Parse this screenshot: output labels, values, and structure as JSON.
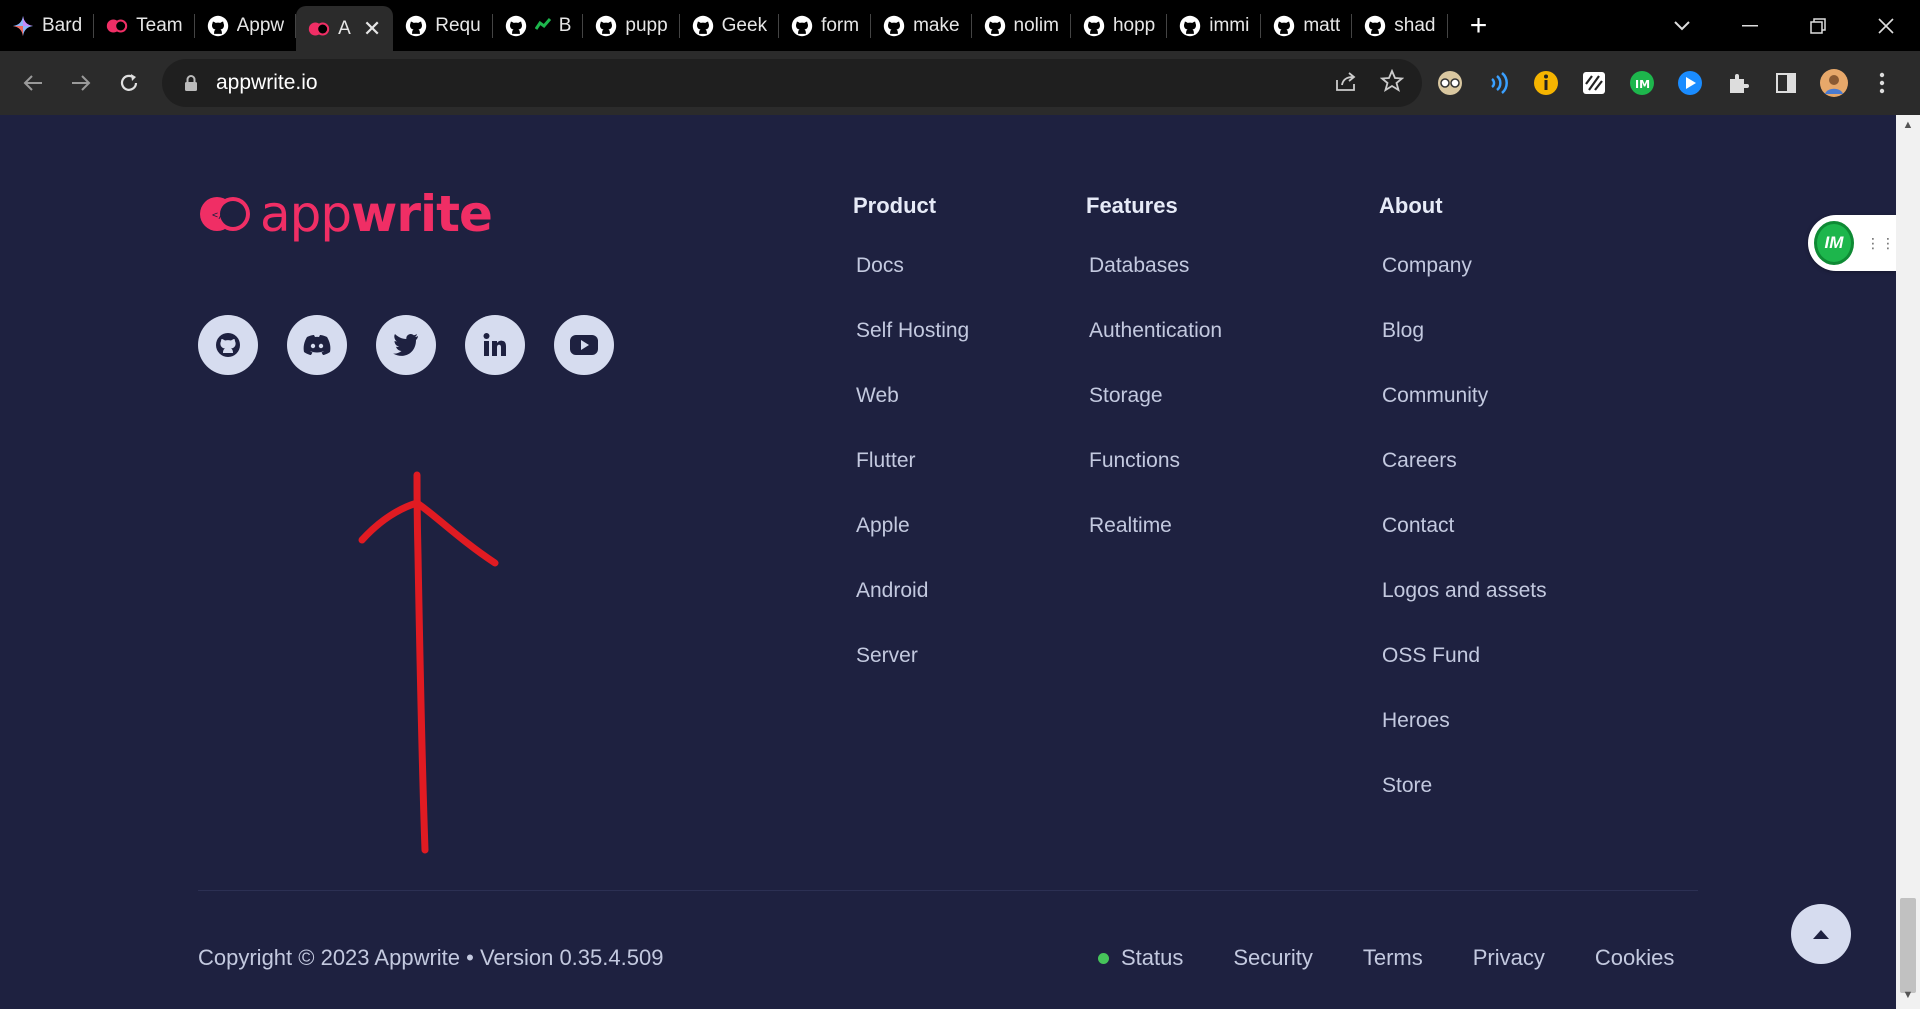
{
  "browser": {
    "tabs": [
      {
        "label": "Bard",
        "icon": "bard-icon",
        "active": false
      },
      {
        "label": "Team",
        "icon": "appwrite-icon",
        "active": false
      },
      {
        "label": "Appw",
        "icon": "github-icon",
        "active": false
      },
      {
        "label": "A",
        "icon": "appwrite-icon",
        "active": true
      },
      {
        "label": "Requ",
        "icon": "github-icon",
        "active": false
      },
      {
        "label": "B",
        "icon": "github-icon",
        "active": false
      },
      {
        "label": "pupp",
        "icon": "github-icon",
        "active": false
      },
      {
        "label": "Geek",
        "icon": "github-icon",
        "active": false
      },
      {
        "label": "form",
        "icon": "github-icon",
        "active": false
      },
      {
        "label": "make",
        "icon": "github-icon",
        "active": false
      },
      {
        "label": "nolim",
        "icon": "github-icon",
        "active": false
      },
      {
        "label": "hopp",
        "icon": "github-icon",
        "active": false
      },
      {
        "label": "immi",
        "icon": "github-icon",
        "active": false
      },
      {
        "label": "matt",
        "icon": "github-icon",
        "active": false
      },
      {
        "label": "shad",
        "icon": "github-icon",
        "active": false
      }
    ],
    "url": "appwrite.io"
  },
  "footer": {
    "logo": {
      "light": "app",
      "bold": "write"
    },
    "socials": [
      "github-icon",
      "discord-icon",
      "twitter-icon",
      "linkedin-icon",
      "youtube-icon"
    ],
    "columns": [
      {
        "title": "Product",
        "items": [
          "Docs",
          "Self Hosting",
          "Web",
          "Flutter",
          "Apple",
          "Android",
          "Server"
        ]
      },
      {
        "title": "Features",
        "items": [
          "Databases",
          "Authentication",
          "Storage",
          "Functions",
          "Realtime"
        ]
      },
      {
        "title": "About",
        "items": [
          "Company",
          "Blog",
          "Community",
          "Careers",
          "Contact",
          "Logos and assets",
          "OSS Fund",
          "Heroes",
          "Store"
        ]
      }
    ],
    "copyright": "Copyright © 2023 Appwrite • Version 0.35.4.509",
    "bottom_links": [
      "Status",
      "Security",
      "Terms",
      "Privacy",
      "Cookies"
    ]
  },
  "widget": {
    "badge": "IM"
  },
  "colors": {
    "accent": "#f02e65",
    "background": "#1e2140",
    "status": "#46c45a"
  }
}
